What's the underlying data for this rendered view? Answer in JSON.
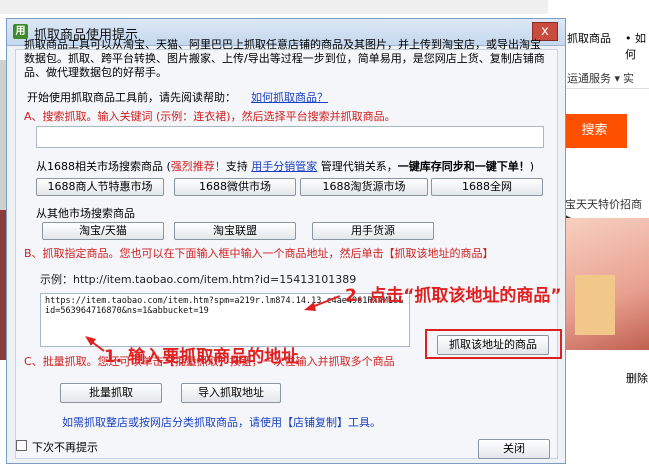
{
  "background": {
    "right_top_1": "抓取商品",
    "right_top_2": "• 如何",
    "right_service": "运通服务 ▾",
    "right_service_2": "实",
    "search_button": "搜索",
    "promo": "宝天天特价招商 ▶",
    "delete": "删除"
  },
  "dialog": {
    "app_icon": "用",
    "title": "抓取商品使用提示",
    "close_label": "x",
    "intro": "抓取商品工具可以从淘宝、天猫、阿里巴巴上抓取任意店铺的商品及其图片，并上传到淘宝店，或导出淘宝数据包。抓取、跨平台转换、图片搬家、上传/导出等过程一步到位，简单易用，是您网店上货、复制店铺商品、做代理数据包的好帮手。",
    "start_text": "开始使用抓取商品工具前，请先阅读帮助：",
    "help_link": "如何抓取商品？",
    "section_a": "A、搜索抓取。输入关键词 (示例：连衣裙)，然后选择平台搜索并抓取商品。",
    "keyword_value": "",
    "market_1688": {
      "prefix": "从1688相关市场搜索商品 (",
      "recommend": "强烈推荐！",
      "support": "支持 ",
      "link": "用手分销管家",
      "suffix": " 管理代销关系，",
      "bold": "一键库存同步和一键下单！",
      "close_paren": ")"
    },
    "buttons_1688": [
      "1688商人节特惠市场",
      "1688微供市场",
      "1688淘货源市场",
      "1688全网"
    ],
    "other_market_label": "从其他市场搜索商品",
    "buttons_other": [
      "淘宝/天猫",
      "淘宝联盟",
      "用手货源"
    ],
    "section_b": "B、抓取指定商品。您也可以在下面输入框中输入一个商品地址，然后单击【抓取该地址的商品】",
    "example": "示例：http://item.taobao.com/item.htm?id=15413101389",
    "url_value": "https://item.taobao.com/item.htm?spm=a219r.lm874.14.13.c4ae4961RXnM1e&id=563964716870&ns=1&abbucket=19",
    "fetch_button": "抓取该地址的商品",
    "section_c": "C、批量抓取。您还可以单击【批量抓取】按钮，一次性输入并抓取多个商品",
    "batch_button": "批量抓取",
    "import_button": "导入抓取地址",
    "bottom_note": "如需抓取整店或按网店分类抓取商品，请使用【店铺复制】工具。",
    "checkbox_label": "下次不再提示",
    "close_button": "关闭"
  },
  "annotations": {
    "step1": "1. 输入要抓取商品的地址",
    "step2": "2. 点击“抓取该地址的商品”",
    "color": "#e02020"
  }
}
